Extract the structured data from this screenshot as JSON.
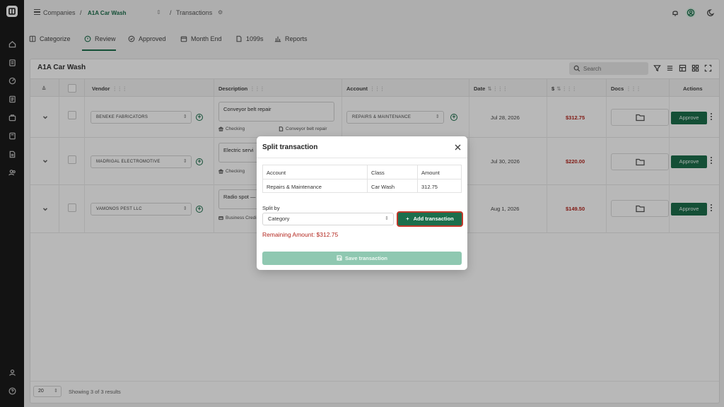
{
  "breadcrumb": {
    "root": "Companies",
    "company": "A1A Car Wash",
    "page": "Transactions"
  },
  "tabs": [
    {
      "label": "Categorize",
      "icon": "categorize-icon"
    },
    {
      "label": "Review",
      "icon": "review-icon",
      "active": true
    },
    {
      "label": "Approved",
      "icon": "approved-icon"
    },
    {
      "label": "Month End",
      "icon": "calendar-icon"
    },
    {
      "label": "1099s",
      "icon": "document-icon"
    },
    {
      "label": "Reports",
      "icon": "bar-chart-icon"
    }
  ],
  "table": {
    "title": "A1A Car Wash",
    "search_placeholder": "Search",
    "columns": {
      "vendor": "Vendor",
      "description": "Description",
      "account": "Account",
      "date": "Date",
      "amount": "$",
      "docs": "Docs",
      "actions": "Actions"
    },
    "rows": [
      {
        "vendor": "BENEKE FABRICATORS",
        "description": "Conveyor belt repair",
        "bank": "Checking",
        "memo": "Conveyor belt repair",
        "account": "REPAIRS & MAINTENANCE",
        "date": "Jul 28, 2026",
        "amount": "$312.75",
        "approve": "Approve"
      },
      {
        "vendor": "MADRIGAL ELECTROMOTIVE",
        "description": "Electric servi",
        "bank": "Checking",
        "date": "Jul 30, 2026",
        "amount": "$220.00",
        "approve": "Approve"
      },
      {
        "vendor": "VAMONOS PEST LLC",
        "description": "Radio spot —",
        "bank": "Business Credi",
        "date": "Aug 1, 2026",
        "amount": "$149.50",
        "approve": "Approve"
      }
    ],
    "page_size": "20",
    "results_text": "Showing 3 of 3 results"
  },
  "modal": {
    "title": "Split transaction",
    "headers": {
      "account": "Account",
      "class": "Class",
      "amount": "Amount"
    },
    "row": {
      "account": "Repairs & Maintenance",
      "class": "Car Wash",
      "amount": "312.75"
    },
    "split_by_label": "Split by",
    "split_by_value": "Category",
    "add_label": "Add transaction",
    "remaining": "Remaining Amount: $312.75",
    "save_label": "Save transaction"
  },
  "colors": {
    "brand": "#1c6e4c",
    "amount_red": "#b3261e",
    "sidebar": "#1b1b1b"
  }
}
